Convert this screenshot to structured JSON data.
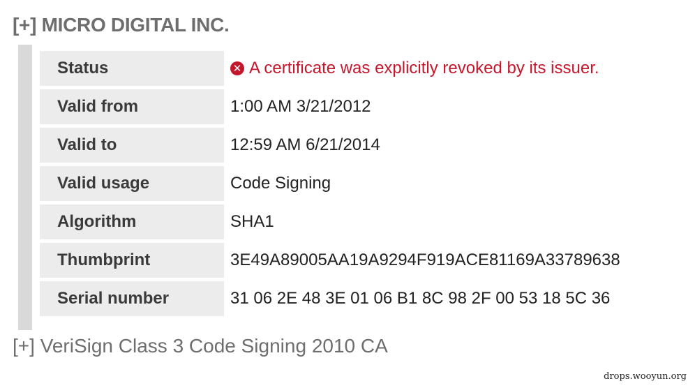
{
  "signer": {
    "toggle": "[+]",
    "name": "MICRO DIGITAL INC."
  },
  "details": {
    "status": {
      "label": "Status",
      "icon": "error-x-circle-icon",
      "value": "A certificate was explicitly revoked by its issuer.",
      "color": "#c4172c"
    },
    "valid_from": {
      "label": "Valid from",
      "value": "1:00 AM 3/21/2012"
    },
    "valid_to": {
      "label": "Valid to",
      "value": "12:59 AM 6/21/2014"
    },
    "valid_usage": {
      "label": "Valid usage",
      "value": "Code Signing"
    },
    "algorithm": {
      "label": "Algorithm",
      "value": "SHA1"
    },
    "thumbprint": {
      "label": "Thumbprint",
      "value": "3E49A89005AA19A9294F919ACE81169A33789638"
    },
    "serial_number": {
      "label": "Serial number",
      "value": "31 06 2E 48 3E 01 06 B1 8C 98 2F 00 53 18 5C 36"
    }
  },
  "issuer": {
    "toggle": "[+]",
    "name": "VeriSign Class 3 Code Signing 2010 CA"
  },
  "watermark": "drops.wooyun.org"
}
